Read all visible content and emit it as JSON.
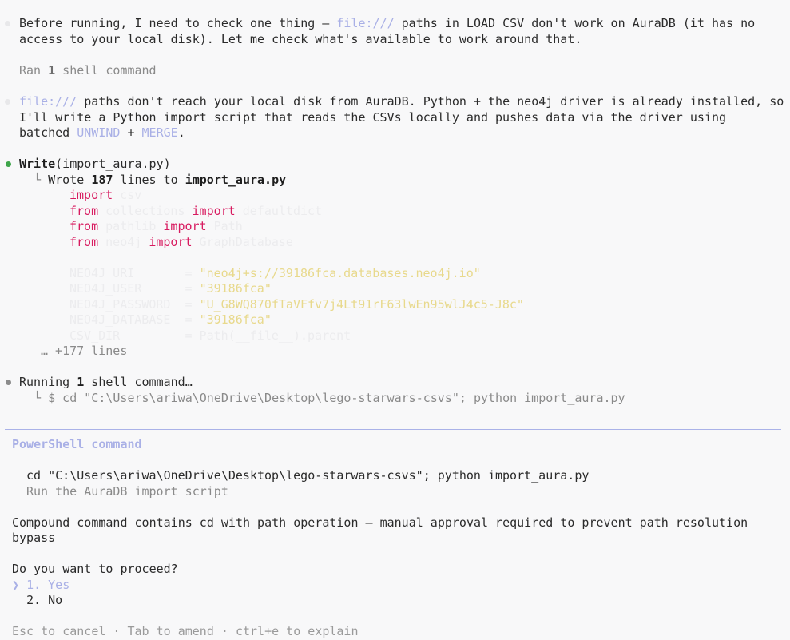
{
  "messages": {
    "intro": {
      "line1_pre": "Before running, I need to check one thing — ",
      "line1_link": "file:///",
      "line1_post": " paths in LOAD CSV don't work on AuraDB (it has no",
      "line2": "access to your local disk). Let me check what's available to work around that."
    },
    "ran": {
      "pre": "Ran ",
      "count": "1",
      "post": " shell command"
    },
    "plan": {
      "line1_link": "file:///",
      "line1_post": " paths don't reach your local disk from AuraDB. Python + the neo4j driver is already installed, so",
      "line2": "I'll write a Python import script that reads the CSVs locally and pushes data via the driver using",
      "line3_pre": "batched ",
      "line3_kw1": "UNWIND",
      "line3_mid": " + ",
      "line3_kw2": "MERGE",
      "line3_post": "."
    },
    "write_tool": {
      "name": "Write",
      "arg": "(import_aura.py)",
      "result_pre": "Wrote ",
      "result_count": "187",
      "result_mid": " lines to ",
      "result_file": "import_aura.py",
      "more_lines": "… +177 lines"
    },
    "code_preview": {
      "l1_kw": "import",
      "l1_rest": " csv",
      "l2_kw1": "from",
      "l2_mid": " collections ",
      "l2_kw2": "import",
      "l2_rest": " defaultdict",
      "l3_kw1": "from",
      "l3_mid": " pathlib ",
      "l3_kw2": "import",
      "l3_rest": " Path",
      "l4_kw1": "from",
      "l4_mid": " neo4j ",
      "l4_kw2": "import",
      "l4_rest": " GraphDatabase",
      "c1_name": "NEO4J_URI       = ",
      "c1_val": "\"neo4j+s://39186fca.databases.neo4j.io\"",
      "c2_name": "NEO4J_USER      = ",
      "c2_val": "\"39186fca\"",
      "c3_name": "NEO4J_PASSWORD  = ",
      "c3_val": "\"U_G8WQ870fTaVFfv7j4Lt91rF63lwEn95wlJ4c5-J8c\"",
      "c4_name": "NEO4J_DATABASE  = ",
      "c4_val": "\"39186fca\"",
      "c5": "CSV_DIR         = Path(__file__).parent"
    },
    "running": {
      "pre": "Running ",
      "count": "1",
      "post": " shell command…",
      "command": "$ cd \"C:\\Users\\ariwa\\OneDrive\\Desktop\\lego-starwars-csvs\"; python import_aura.py"
    }
  },
  "prompt": {
    "title": "PowerShell command",
    "command": "cd \"C:\\Users\\ariwa\\OneDrive\\Desktop\\lego-starwars-csvs\"; python import_aura.py",
    "description": "Run the AuraDB import script",
    "warning_line1": "Compound command contains cd with path operation — manual approval required to prevent path resolution",
    "warning_line2": "bypass",
    "question": "Do you want to proceed?",
    "options": [
      {
        "marker": "❯",
        "label": "1. Yes"
      },
      {
        "marker": " ",
        "label": "2. No"
      }
    ],
    "footer": "Esc to cancel · Tab to amend · ctrl+e to explain"
  },
  "colors": {
    "accent": "#a9b0e6",
    "keyword": "#d81b60",
    "success": "#3fa54b"
  }
}
